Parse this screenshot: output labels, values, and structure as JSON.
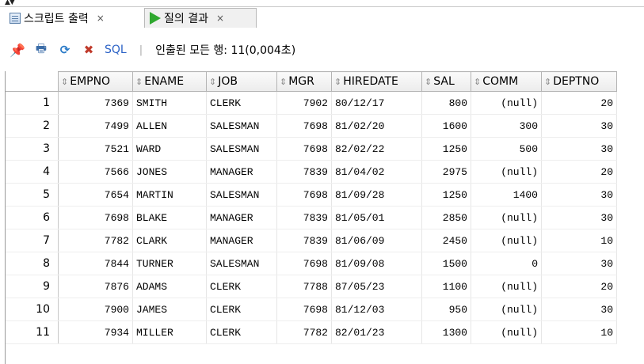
{
  "tabs": [
    {
      "label": "스크립트 출력",
      "close": "×",
      "icon": "script-output-icon"
    },
    {
      "label": "질의 결과",
      "close": "×",
      "icon": "run-query-icon"
    }
  ],
  "toolbar": {
    "icons": [
      "pin-icon",
      "print-icon",
      "refresh-icon",
      "export-icon"
    ],
    "sql_label": "SQL",
    "separator": "|",
    "status": "인출된 모든 행: 11(0,004초)"
  },
  "grid": {
    "columns": [
      "EMPNO",
      "ENAME",
      "JOB",
      "MGR",
      "HIREDATE",
      "SAL",
      "COMM",
      "DEPTNO"
    ],
    "rows": [
      {
        "rn": "1",
        "empno": "7369",
        "ename": "SMITH",
        "job": "CLERK",
        "mgr": "7902",
        "hiredate": "80/12/17",
        "sal": "800",
        "comm": "(null)",
        "deptno": "20"
      },
      {
        "rn": "2",
        "empno": "7499",
        "ename": "ALLEN",
        "job": "SALESMAN",
        "mgr": "7698",
        "hiredate": "81/02/20",
        "sal": "1600",
        "comm": "300",
        "deptno": "30"
      },
      {
        "rn": "3",
        "empno": "7521",
        "ename": "WARD",
        "job": "SALESMAN",
        "mgr": "7698",
        "hiredate": "82/02/22",
        "sal": "1250",
        "comm": "500",
        "deptno": "30"
      },
      {
        "rn": "4",
        "empno": "7566",
        "ename": "JONES",
        "job": "MANAGER",
        "mgr": "7839",
        "hiredate": "81/04/02",
        "sal": "2975",
        "comm": "(null)",
        "deptno": "20"
      },
      {
        "rn": "5",
        "empno": "7654",
        "ename": "MARTIN",
        "job": "SALESMAN",
        "mgr": "7698",
        "hiredate": "81/09/28",
        "sal": "1250",
        "comm": "1400",
        "deptno": "30"
      },
      {
        "rn": "6",
        "empno": "7698",
        "ename": "BLAKE",
        "job": "MANAGER",
        "mgr": "7839",
        "hiredate": "81/05/01",
        "sal": "2850",
        "comm": "(null)",
        "deptno": "30"
      },
      {
        "rn": "7",
        "empno": "7782",
        "ename": "CLARK",
        "job": "MANAGER",
        "mgr": "7839",
        "hiredate": "81/06/09",
        "sal": "2450",
        "comm": "(null)",
        "deptno": "10"
      },
      {
        "rn": "8",
        "empno": "7844",
        "ename": "TURNER",
        "job": "SALESMAN",
        "mgr": "7698",
        "hiredate": "81/09/08",
        "sal": "1500",
        "comm": "0",
        "deptno": "30"
      },
      {
        "rn": "9",
        "empno": "7876",
        "ename": "ADAMS",
        "job": "CLERK",
        "mgr": "7788",
        "hiredate": "87/05/23",
        "sal": "1100",
        "comm": "(null)",
        "deptno": "20"
      },
      {
        "rn": "10",
        "empno": "7900",
        "ename": "JAMES",
        "job": "CLERK",
        "mgr": "7698",
        "hiredate": "81/12/03",
        "sal": "950",
        "comm": "(null)",
        "deptno": "30"
      },
      {
        "rn": "11",
        "empno": "7934",
        "ename": "MILLER",
        "job": "CLERK",
        "mgr": "7782",
        "hiredate": "82/01/23",
        "sal": "1300",
        "comm": "(null)",
        "deptno": "10"
      }
    ]
  }
}
